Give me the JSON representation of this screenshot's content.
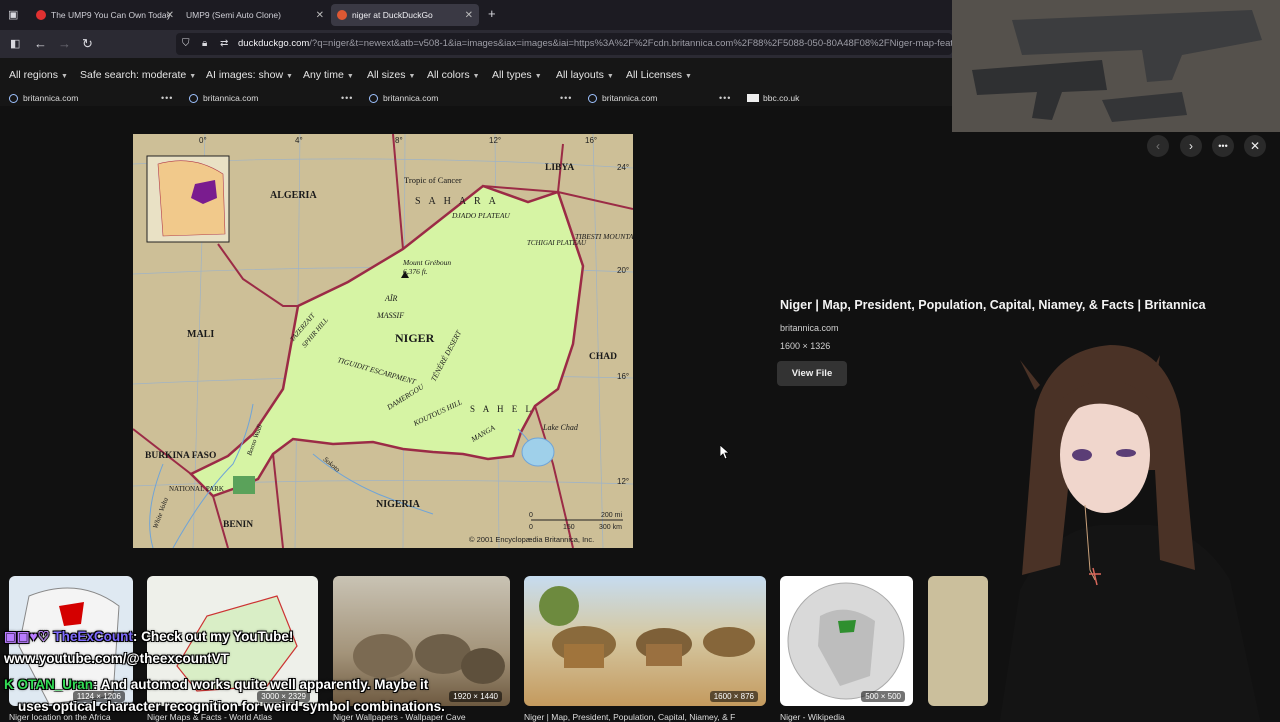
{
  "browser": {
    "tabs": [
      {
        "title": "The UMP9 You Can Own Today",
        "favicon_color": "#e03131"
      },
      {
        "title": "UMP9 (Semi Auto Clone)",
        "favicon_color": ""
      },
      {
        "title": "niger at DuckDuckGo",
        "favicon_color": "#de5833"
      }
    ],
    "new_tab_label": "+",
    "url_domain": "duckduckgo.com",
    "url_rest": "/?q=niger&t=newext&atb=v508-1&ia=images&iax=images&iai=https%3A%2F%2Fcdn.britannica.com%2F88%2F5088-050-80A48F08%2FNiger-map-features-"
  },
  "filters": [
    "All regions",
    "Safe search: moderate",
    "AI images: show",
    "Any time",
    "All sizes",
    "All colors",
    "All types",
    "All layouts",
    "All Licenses"
  ],
  "sources": [
    "britannica.com",
    "britannica.com",
    "britannica.com",
    "britannica.com",
    "bbc.co.uk"
  ],
  "map": {
    "labels": {
      "libya": "LIBYA",
      "algeria": "ALGERIA",
      "tropic": "Tropic of Cancer",
      "sahara": "S A H A R A",
      "djado": "DJADO PLATEAU",
      "tchigai": "TCHIGAI PLATEAU",
      "tibesti": "TIBESTI MOUNTAINS",
      "greboun": "Mount Gréboun",
      "greboun_alt": "6,376 ft.",
      "air": "AÏR",
      "massif": "MASSIF",
      "mali": "MALI",
      "niger": "NIGER",
      "tazerzait": "TAZERZAIT",
      "sphir": "SPHIR HILL",
      "tiguidit": "TIGUIDIT ESCARPMENT",
      "tenere": "TÉNÉRÉ DESERT",
      "damergou": "DAMERGOU",
      "koutous": "KOUTOUS HILL",
      "sahel": "S A H E L",
      "manga": "MANGA",
      "chad": "CHAD",
      "lake_chad": "Lake Chad",
      "burkina": "BURKINA FASO",
      "national_park": "NATIONAL PARK",
      "white_volta": "White Volta",
      "bosso": "Bosso Wadi",
      "sokoto": "Sokoto",
      "nigeria": "NIGERIA",
      "benin": "BENIN",
      "copyright": "© 2001 Encyclopædia Britannica, Inc.",
      "scale_mi": "200 mi",
      "scale_km": "300 km",
      "scale_0": "0",
      "scale_100": "100",
      "scale_150": "150"
    },
    "longitudes": [
      "0°",
      "4°",
      "8°",
      "12°",
      "16°"
    ],
    "latitudes": [
      "24°",
      "20°",
      "16°",
      "12°"
    ]
  },
  "detail": {
    "title": "Niger | Map, President, Population, Capital, Niamey, & Facts | Britannica",
    "source": "britannica.com",
    "dimensions": "1600 × 1326",
    "view_file": "View File"
  },
  "thumbnails": [
    {
      "dim": "1124 × 1206",
      "caption": "Niger location on the Africa"
    },
    {
      "dim": "3000 × 2329",
      "caption": "Niger Maps & Facts - World Atlas"
    },
    {
      "dim": "1920 × 1440",
      "caption": "Niger Wallpapers - Wallpaper Cave"
    },
    {
      "dim": "1600 × 876",
      "caption": "Niger | Map, President, Population, Capital, Niamey, & F"
    },
    {
      "dim": "500 × 500",
      "caption": "Niger - Wikipedia"
    }
  ],
  "chat": [
    {
      "user": "TheExCount",
      "text": ": Check out my YouTube!"
    },
    {
      "user": "",
      "text": "www.youtube.com/@theexcountVT"
    },
    {
      "user": "OTAN_Uran",
      "text": ": And automod works quite well apparently. Maybe it"
    },
    {
      "user": "",
      "text": "uses optical character recognition for weird symbol combinations."
    }
  ]
}
